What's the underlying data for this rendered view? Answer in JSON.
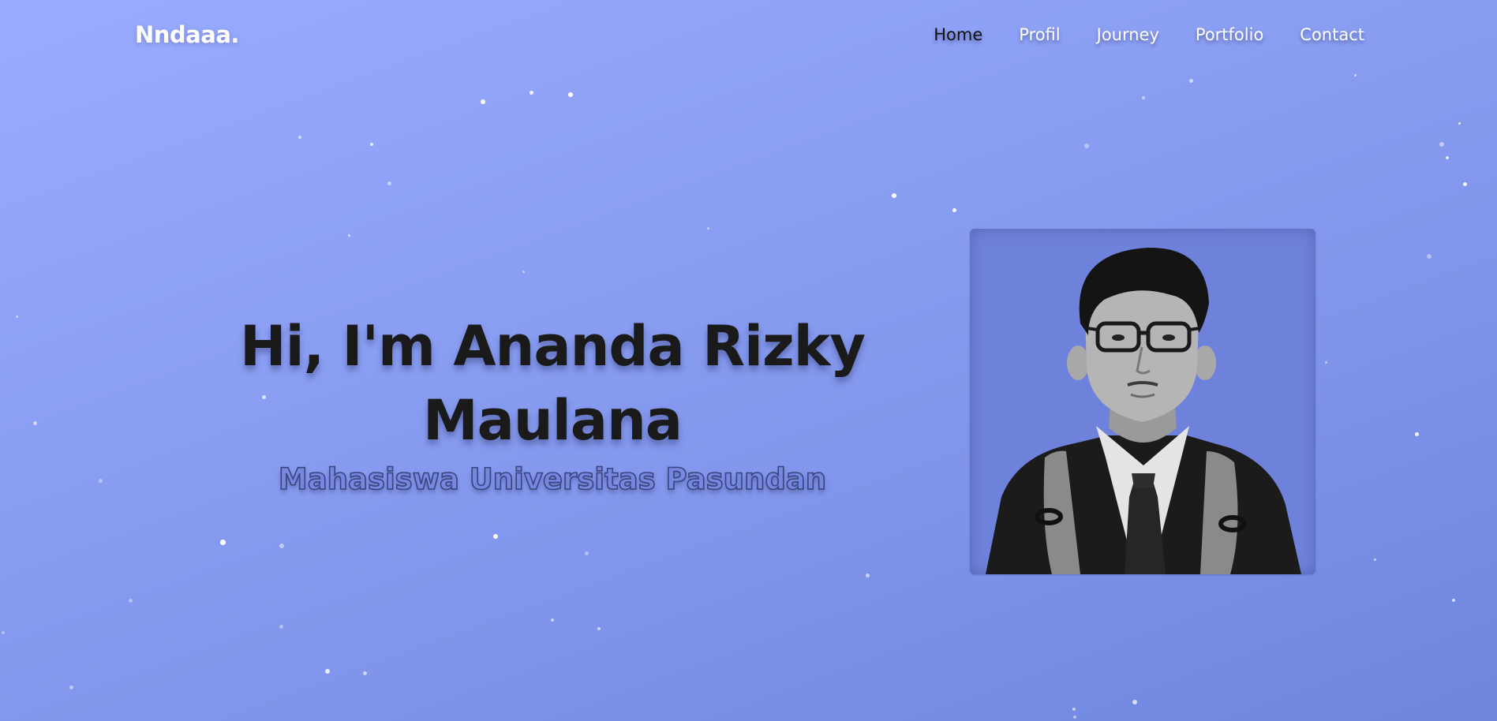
{
  "logo": "Nndaaa.",
  "nav": {
    "items": [
      {
        "label": "Home",
        "active": true
      },
      {
        "label": "Profil",
        "active": false
      },
      {
        "label": "Journey",
        "active": false
      },
      {
        "label": "Portfolio",
        "active": false
      },
      {
        "label": "Contact",
        "active": false
      }
    ]
  },
  "hero": {
    "title_line1": "Hi, I'm Ananda Rizky",
    "title_line2": "Maulana",
    "subtitle": "Mahasiswa Universitas Pasundan"
  },
  "colors": {
    "background_start": "#9aabff",
    "background_end": "#6f84dd",
    "title_text": "#1a1a1a",
    "nav_active": "#111111",
    "nav_text": "#ffffff"
  }
}
